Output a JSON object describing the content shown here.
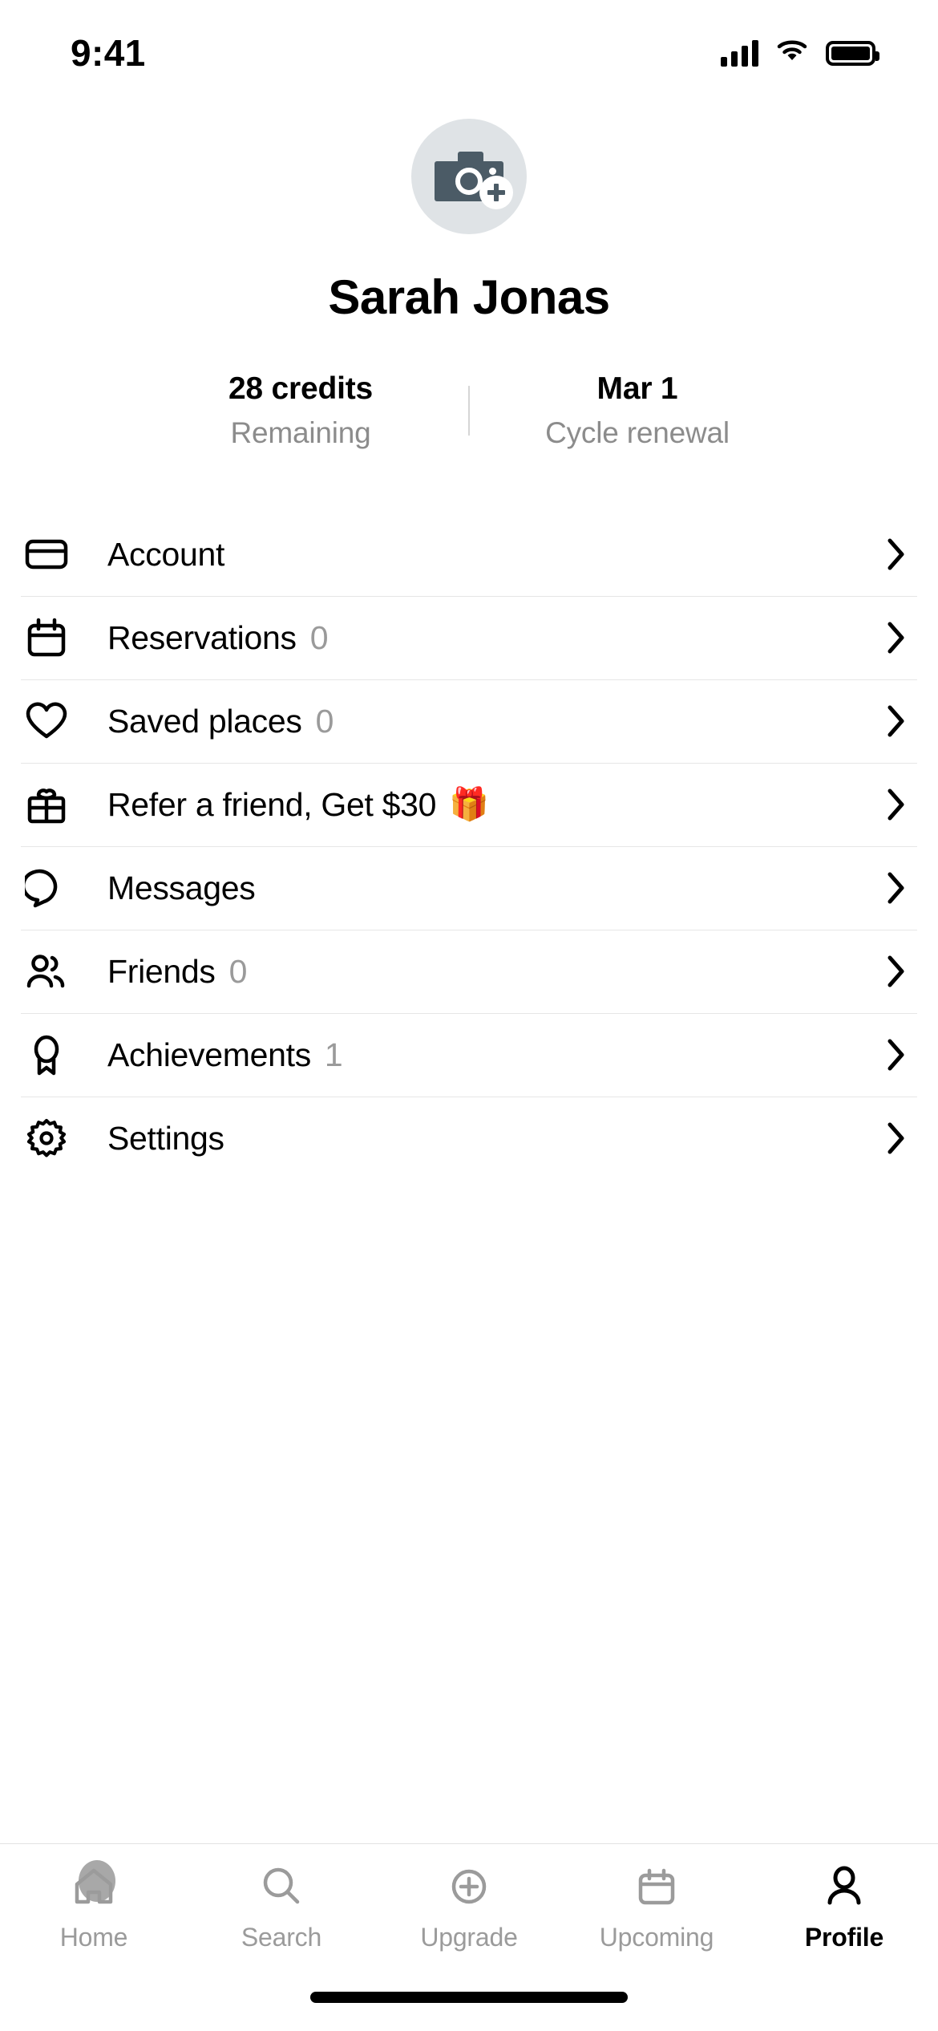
{
  "status_bar": {
    "time": "9:41",
    "signal_icon": "cellular-signal-icon",
    "wifi_icon": "wifi-icon",
    "battery_icon": "battery-full-icon"
  },
  "profile": {
    "avatar_icon": "camera-add-photo-icon",
    "avatar_bg": "#dfe3e6",
    "avatar_fg": "#4b5b66",
    "name": "Sarah Jonas"
  },
  "stats": [
    {
      "value": "28 credits",
      "label": "Remaining"
    },
    {
      "value": "Mar 1",
      "label": "Cycle renewal"
    }
  ],
  "menu": {
    "items": [
      {
        "icon": "credit-card-icon",
        "label": "Account",
        "count": "",
        "emoji": "",
        "chevron": "chevron-right-icon"
      },
      {
        "icon": "calendar-icon",
        "label": "Reservations",
        "count": "0",
        "emoji": "",
        "chevron": "chevron-right-icon"
      },
      {
        "icon": "heart-icon",
        "label": "Saved places",
        "count": "0",
        "emoji": "",
        "chevron": "chevron-right-icon"
      },
      {
        "icon": "gift-icon",
        "label": "Refer a friend, Get $30",
        "count": "",
        "emoji": "🎁",
        "chevron": "chevron-right-icon"
      },
      {
        "icon": "chat-bubble-icon",
        "label": "Messages",
        "count": "",
        "emoji": "",
        "chevron": "chevron-right-icon"
      },
      {
        "icon": "friends-icon",
        "label": "Friends",
        "count": "0",
        "emoji": "",
        "chevron": "chevron-right-icon"
      },
      {
        "icon": "award-ribbon-icon",
        "label": "Achievements",
        "count": "1",
        "emoji": "",
        "chevron": "chevron-right-icon"
      },
      {
        "icon": "gear-icon",
        "label": "Settings",
        "count": "",
        "emoji": "",
        "chevron": "chevron-right-icon"
      }
    ]
  },
  "tabbar": {
    "active": "Profile",
    "items": [
      {
        "icon": "home-icon",
        "label": "Home",
        "active": false
      },
      {
        "icon": "search-icon",
        "label": "Search",
        "active": false
      },
      {
        "icon": "plus-circle-icon",
        "label": "Upgrade",
        "active": false
      },
      {
        "icon": "calendar-icon",
        "label": "Upcoming",
        "active": false
      },
      {
        "icon": "person-icon",
        "label": "Profile",
        "active": true
      }
    ]
  },
  "colors": {
    "text_primary": "#000000",
    "text_muted": "#9a9a9a",
    "tab_inactive": "#9b9b9b",
    "divider": "#e6e6e6",
    "avatar_bg": "#dfe3e6"
  },
  "home_indicator": {
    "visible": true
  }
}
